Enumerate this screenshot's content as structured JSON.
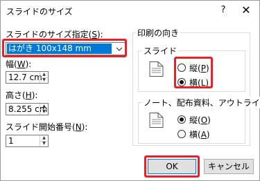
{
  "window": {
    "title": "スライドのサイズ",
    "help_glyph": "?",
    "close_glyph": "✕"
  },
  "size_for": {
    "label_pre": "スライドのサイズ指定(",
    "label_key": "S",
    "label_post": "):",
    "selected": "はがき 100x148 mm"
  },
  "width": {
    "label_pre": "幅(",
    "label_key": "W",
    "label_post": "):",
    "value": "12.7 cm"
  },
  "height": {
    "label_pre": "高さ(",
    "label_key": "H",
    "label_post": "):",
    "value": "8.255 cm"
  },
  "start_number": {
    "label_pre": "スライド開始番号(",
    "label_key": "N",
    "label_post": "):",
    "value": "1"
  },
  "orientation": {
    "group_label": "印刷の向き",
    "slides": {
      "label": "スライド",
      "portrait_pre": "縦(",
      "portrait_key": "P",
      "portrait_post": ")",
      "landscape_pre": "横(",
      "landscape_key": "L",
      "landscape_post": ")",
      "selected": "landscape"
    },
    "notes": {
      "label": "ノート、配布資料、アウトライン",
      "portrait_pre": "縦(",
      "portrait_key": "O",
      "portrait_post": ")",
      "landscape_pre": "横(",
      "landscape_key": "A",
      "landscape_post": ")",
      "selected": "portrait"
    }
  },
  "buttons": {
    "ok": "OK",
    "cancel": "キャンセル"
  },
  "highlight_color": "#e8202a",
  "accent_color": "#0078d7"
}
